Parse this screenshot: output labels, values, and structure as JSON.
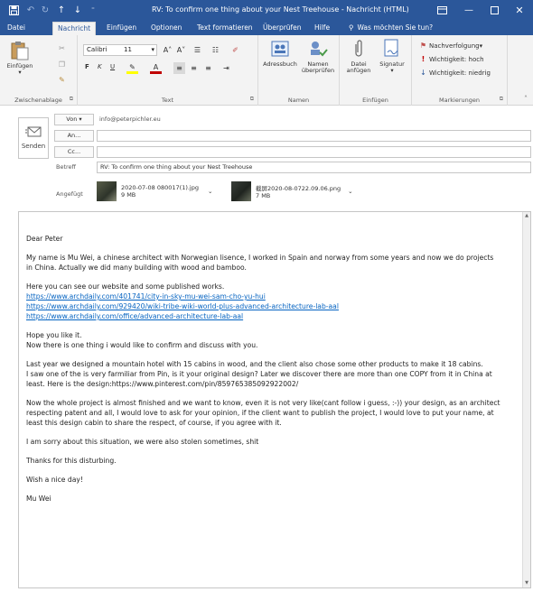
{
  "window": {
    "title": "RV: To confirm one thing about your Nest Treehouse  -  Nachricht (HTML)",
    "qa_icons": [
      "save-icon",
      "undo-icon",
      "redo-icon",
      "up-arrow-icon",
      "down-arrow-icon",
      "customize-icon"
    ],
    "controls": [
      "restore-ribbon-icon",
      "minimize-icon",
      "maximize-icon",
      "close-icon"
    ]
  },
  "tabs": [
    "Datei",
    "Nachricht",
    "Einfügen",
    "Optionen",
    "Text formatieren",
    "Überprüfen",
    "Hilfe",
    "Was möchten Sie tun?"
  ],
  "active_tab": "Nachricht",
  "ribbon": {
    "clipboard": {
      "paste": "Einfügen",
      "label": "Zwischenablage"
    },
    "text": {
      "font": "Calibri",
      "size": "11",
      "label": "Text",
      "bold": "F",
      "italic": "K",
      "underline": "U"
    },
    "names": {
      "address_book": "Adressbuch",
      "check_names_1": "Namen",
      "check_names_2": "überprüfen",
      "label": "Namen"
    },
    "include": {
      "attach_1": "Datei",
      "attach_2": "anfügen",
      "signature": "Signatur",
      "label": "Einfügen"
    },
    "tags": {
      "followup": "Nachverfolgung",
      "high": "Wichtigkeit: hoch",
      "low": "Wichtigkeit: niedrig",
      "label": "Markierungen"
    }
  },
  "header": {
    "send": "Senden",
    "from_btn": "Von",
    "from_value": "info@peterpichler.eu",
    "to_btn": "An...",
    "cc_btn": "Cc...",
    "subject_label": "Betreff",
    "subject_value": "RV: To confirm one thing about your Nest Treehouse",
    "attached_label": "Angefügt",
    "attachments": [
      {
        "name": "2020-07-08 080017(1).jpg",
        "size": "9 MB"
      },
      {
        "name": "截屏2020-08-0722.09.06.png",
        "size": "7 MB"
      }
    ]
  },
  "body": {
    "greeting": "Dear Peter",
    "p1a": "My name is Mu Wei, a chinese architect with Norwegian lisence, I worked in Spain and norway from some years and now we do projects",
    "p1b": "in China. Actually we did many building with wood and bamboo.",
    "p2": "Here you can see our website and some published works.",
    "links": [
      "https://www.archdaily.com/401741/city-in-sky-mu-wei-sam-cho-yu-hui",
      "https://www.archdaily.com/929420/wiki-tribe-wiki-world-plus-advanced-architecture-lab-aal",
      "https://www.archdaily.com/office/advanced-architecture-lab-aal"
    ],
    "p3a": "Hope you like it.",
    "p3b": "Now there is one thing i would like to confirm and discuss with you.",
    "p4a": "Last year we designed a mountain hotel with 15 cabins in wood, and the client also chose some other products to make it 18 cabins.",
    "p4b": "I saw one of the is very farmiliar from Pin, is it your original design? Later we discover there are more than one COPY from it in China at",
    "p4c": "least. Here is the design:https://www.pinterest.com/pin/859765385092922002/",
    "p5a": "Now the whole project is almost finished and we want to know, even it is not very like(cant follow i guess, :-)) your design, as an architect",
    "p5b": "respecting patent and all, I would love to ask for your opinion, if the client want to publish the project, I would love to put your name, at",
    "p5c": "least this design cabin to share the respect, of course, if you agree with it.",
    "p6": "I am sorry about this situation, we were also stolen sometimes, shit",
    "p7": "Thanks for this disturbing.",
    "p8": "Wish a nice day!",
    "signature": "Mu Wei"
  }
}
